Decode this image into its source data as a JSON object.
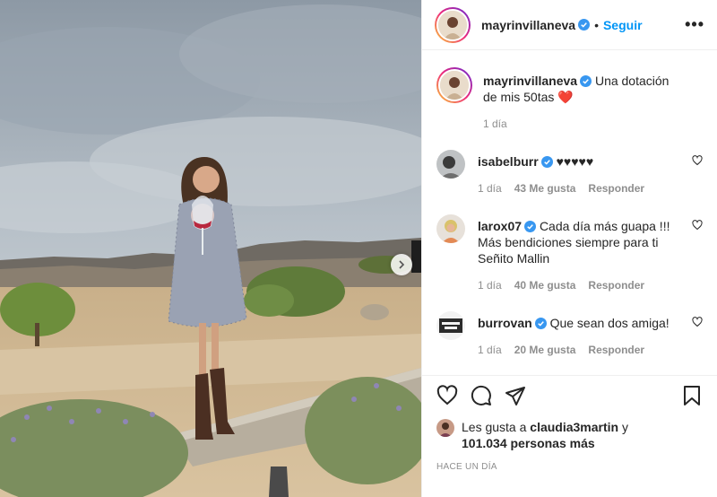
{
  "header": {
    "username": "mayrinvillaneva",
    "separator": "•",
    "follow_label": "Seguir",
    "more_label": "•••"
  },
  "caption": {
    "username": "mayrinvillaneva",
    "text": "Una dotación de mis 50tas",
    "emoji": "❤️",
    "time": "1 día"
  },
  "comments": [
    {
      "username": "isabelburr",
      "text": "♥♥♥♥♥",
      "time": "1 día",
      "likes": "43 Me gusta",
      "reply": "Responder"
    },
    {
      "username": "larox07",
      "text": "Cada día más guapa !!! Más bendiciones siempre para ti Señito Mallin",
      "time": "1 día",
      "likes": "40 Me gusta",
      "reply": "Responder"
    },
    {
      "username": "burrovan",
      "text": "Que sean dos amiga!",
      "time": "1 día",
      "likes": "20 Me gusta",
      "reply": "Responder"
    }
  ],
  "likes": {
    "prefix": "Les gusta a",
    "user": "claudia3martin",
    "conj": "y",
    "count": "101.034 personas más"
  },
  "timestamp": "HACE UN DÍA",
  "colors": {
    "follow": "#0095f6",
    "verified": "#3897f0",
    "heart_emoji": "#ed4956"
  },
  "icons": [
    "verified-badge-icon",
    "more-icon",
    "heart-icon",
    "comment-icon",
    "share-icon",
    "bookmark-icon",
    "next-arrow-icon"
  ]
}
